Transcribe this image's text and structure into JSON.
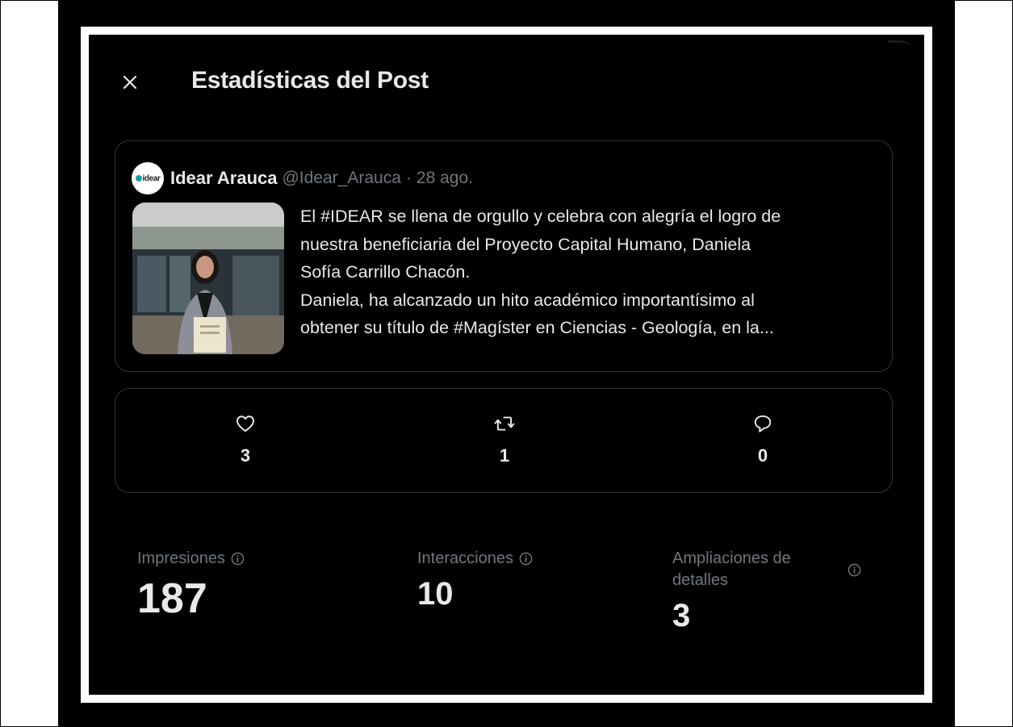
{
  "modal": {
    "title": "Estadísticas del Post",
    "close_icon": "close-icon"
  },
  "post": {
    "avatar_text": "idear",
    "author_name": "Idear Arauca",
    "author_handle": "@Idear_Arauca",
    "separator": "·",
    "date": "28 ago.",
    "text_lines": [
      "El #IDEAR se llena de orgullo y celebra con alegría el logro de",
      "nuestra beneficiaria del Proyecto Capital Humano, Daniela",
      "Sofía Carrillo Chacón.",
      "Daniela, ha alcanzado un hito académico importantísimo al",
      "obtener su título de #Magíster en Ciencias - Geología, en la..."
    ]
  },
  "engagement": {
    "likes": {
      "icon": "heart-icon",
      "value": "3"
    },
    "reposts": {
      "icon": "repost-icon",
      "value": "1"
    },
    "replies": {
      "icon": "reply-icon",
      "value": "0"
    }
  },
  "metrics": {
    "impressions": {
      "label": "Impresiones",
      "value": "187"
    },
    "interactions": {
      "label": "Interacciones",
      "value": "10"
    },
    "detail_expands": {
      "label_line1": "Ampliaciones de",
      "label_line2": "detalles",
      "value": "3"
    }
  },
  "colors": {
    "background": "#000000",
    "text_primary": "#e7e9ea",
    "text_secondary": "#71767b",
    "border": "#2f3336"
  }
}
